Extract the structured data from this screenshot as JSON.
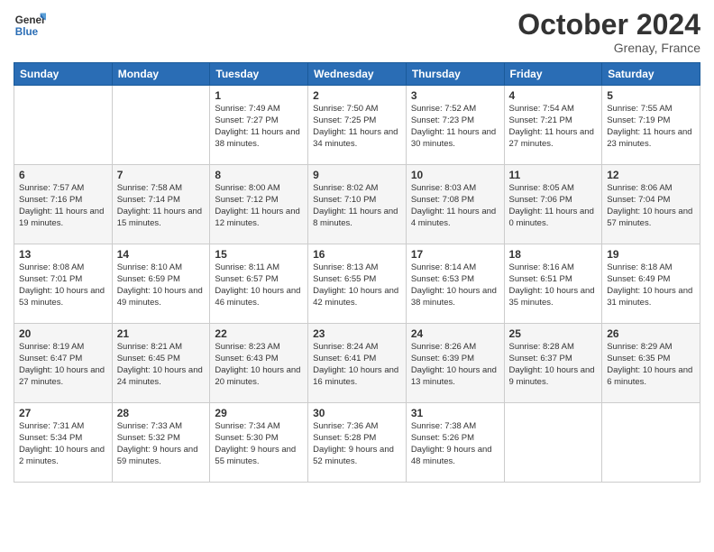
{
  "header": {
    "logo_general": "General",
    "logo_blue": "Blue",
    "month_title": "October 2024",
    "location": "Grenay, France"
  },
  "weekdays": [
    "Sunday",
    "Monday",
    "Tuesday",
    "Wednesday",
    "Thursday",
    "Friday",
    "Saturday"
  ],
  "weeks": [
    [
      {
        "day": "",
        "info": ""
      },
      {
        "day": "",
        "info": ""
      },
      {
        "day": "1",
        "info": "Sunrise: 7:49 AM\nSunset: 7:27 PM\nDaylight: 11 hours and 38 minutes."
      },
      {
        "day": "2",
        "info": "Sunrise: 7:50 AM\nSunset: 7:25 PM\nDaylight: 11 hours and 34 minutes."
      },
      {
        "day": "3",
        "info": "Sunrise: 7:52 AM\nSunset: 7:23 PM\nDaylight: 11 hours and 30 minutes."
      },
      {
        "day": "4",
        "info": "Sunrise: 7:54 AM\nSunset: 7:21 PM\nDaylight: 11 hours and 27 minutes."
      },
      {
        "day": "5",
        "info": "Sunrise: 7:55 AM\nSunset: 7:19 PM\nDaylight: 11 hours and 23 minutes."
      }
    ],
    [
      {
        "day": "6",
        "info": "Sunrise: 7:57 AM\nSunset: 7:16 PM\nDaylight: 11 hours and 19 minutes."
      },
      {
        "day": "7",
        "info": "Sunrise: 7:58 AM\nSunset: 7:14 PM\nDaylight: 11 hours and 15 minutes."
      },
      {
        "day": "8",
        "info": "Sunrise: 8:00 AM\nSunset: 7:12 PM\nDaylight: 11 hours and 12 minutes."
      },
      {
        "day": "9",
        "info": "Sunrise: 8:02 AM\nSunset: 7:10 PM\nDaylight: 11 hours and 8 minutes."
      },
      {
        "day": "10",
        "info": "Sunrise: 8:03 AM\nSunset: 7:08 PM\nDaylight: 11 hours and 4 minutes."
      },
      {
        "day": "11",
        "info": "Sunrise: 8:05 AM\nSunset: 7:06 PM\nDaylight: 11 hours and 0 minutes."
      },
      {
        "day": "12",
        "info": "Sunrise: 8:06 AM\nSunset: 7:04 PM\nDaylight: 10 hours and 57 minutes."
      }
    ],
    [
      {
        "day": "13",
        "info": "Sunrise: 8:08 AM\nSunset: 7:01 PM\nDaylight: 10 hours and 53 minutes."
      },
      {
        "day": "14",
        "info": "Sunrise: 8:10 AM\nSunset: 6:59 PM\nDaylight: 10 hours and 49 minutes."
      },
      {
        "day": "15",
        "info": "Sunrise: 8:11 AM\nSunset: 6:57 PM\nDaylight: 10 hours and 46 minutes."
      },
      {
        "day": "16",
        "info": "Sunrise: 8:13 AM\nSunset: 6:55 PM\nDaylight: 10 hours and 42 minutes."
      },
      {
        "day": "17",
        "info": "Sunrise: 8:14 AM\nSunset: 6:53 PM\nDaylight: 10 hours and 38 minutes."
      },
      {
        "day": "18",
        "info": "Sunrise: 8:16 AM\nSunset: 6:51 PM\nDaylight: 10 hours and 35 minutes."
      },
      {
        "day": "19",
        "info": "Sunrise: 8:18 AM\nSunset: 6:49 PM\nDaylight: 10 hours and 31 minutes."
      }
    ],
    [
      {
        "day": "20",
        "info": "Sunrise: 8:19 AM\nSunset: 6:47 PM\nDaylight: 10 hours and 27 minutes."
      },
      {
        "day": "21",
        "info": "Sunrise: 8:21 AM\nSunset: 6:45 PM\nDaylight: 10 hours and 24 minutes."
      },
      {
        "day": "22",
        "info": "Sunrise: 8:23 AM\nSunset: 6:43 PM\nDaylight: 10 hours and 20 minutes."
      },
      {
        "day": "23",
        "info": "Sunrise: 8:24 AM\nSunset: 6:41 PM\nDaylight: 10 hours and 16 minutes."
      },
      {
        "day": "24",
        "info": "Sunrise: 8:26 AM\nSunset: 6:39 PM\nDaylight: 10 hours and 13 minutes."
      },
      {
        "day": "25",
        "info": "Sunrise: 8:28 AM\nSunset: 6:37 PM\nDaylight: 10 hours and 9 minutes."
      },
      {
        "day": "26",
        "info": "Sunrise: 8:29 AM\nSunset: 6:35 PM\nDaylight: 10 hours and 6 minutes."
      }
    ],
    [
      {
        "day": "27",
        "info": "Sunrise: 7:31 AM\nSunset: 5:34 PM\nDaylight: 10 hours and 2 minutes."
      },
      {
        "day": "28",
        "info": "Sunrise: 7:33 AM\nSunset: 5:32 PM\nDaylight: 9 hours and 59 minutes."
      },
      {
        "day": "29",
        "info": "Sunrise: 7:34 AM\nSunset: 5:30 PM\nDaylight: 9 hours and 55 minutes."
      },
      {
        "day": "30",
        "info": "Sunrise: 7:36 AM\nSunset: 5:28 PM\nDaylight: 9 hours and 52 minutes."
      },
      {
        "day": "31",
        "info": "Sunrise: 7:38 AM\nSunset: 5:26 PM\nDaylight: 9 hours and 48 minutes."
      },
      {
        "day": "",
        "info": ""
      },
      {
        "day": "",
        "info": ""
      }
    ]
  ]
}
